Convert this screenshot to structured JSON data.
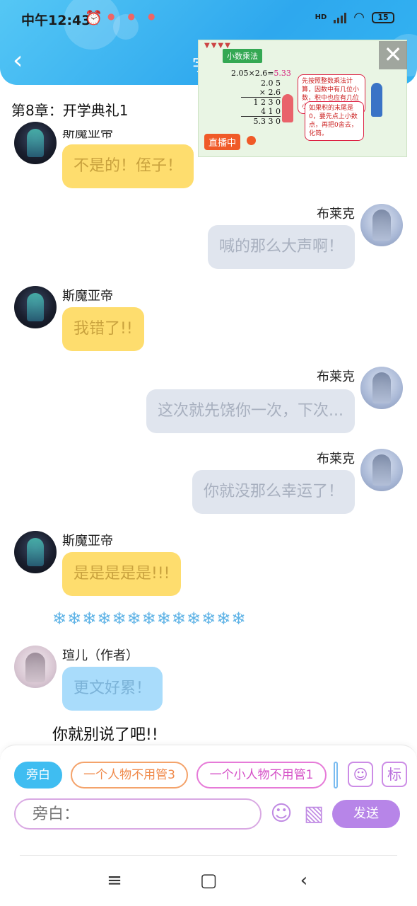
{
  "status_bar": {
    "time": "中午12:43",
    "battery": "15",
    "signal_label": "HD"
  },
  "header": {
    "back_icon": "chevron-left-icon",
    "title_fragment": "宇"
  },
  "chapter_title": "第8章：开学典礼1",
  "video": {
    "topic": "小数乘法",
    "equation": "2.05×2.6=",
    "answer": "5.33",
    "calc_lines": [
      "2.0 5",
      "× 2.6",
      "1 2 3 0",
      "4 1 0",
      "5.3 3 0"
    ],
    "speech_1": "先按照整数乘法计算，因数中有几位小数，积中也应有几位小数。",
    "speech_2": "如果积的末尾是0，要先点上小数点，再把0舍去，化简。",
    "live_label": "直播中",
    "close_icon": "close-icon"
  },
  "messages": [
    {
      "speaker": "斯魔亚帝",
      "side": "left",
      "text": "不是的！侄子！",
      "style": "yellow"
    },
    {
      "speaker": "布莱克",
      "side": "right",
      "text": "喊的那么大声啊！",
      "style": "gray"
    },
    {
      "speaker": "斯魔亚帝",
      "side": "left",
      "text": "我错了!!",
      "style": "yellow"
    },
    {
      "speaker": "布莱克",
      "side": "right",
      "text": "这次就先饶你一次，下次...",
      "style": "gray"
    },
    {
      "speaker": "布莱克",
      "side": "right",
      "text": "你就没那么幸运了！",
      "style": "gray"
    },
    {
      "speaker": "斯魔亚帝",
      "side": "left",
      "text": "是是是是是!!!",
      "style": "yellow"
    },
    {
      "speaker": "瑄儿（作者）",
      "side": "left",
      "text": "更文好累！",
      "style": "blue"
    }
  ],
  "separator": "❄❄❄❄❄❄❄❄❄❄❄❄❄",
  "narration_text": "你就别说了吧!!",
  "composer": {
    "chips": [
      "旁白",
      "一个人物不用管3",
      "一个小人物不用管1"
    ],
    "role_icon": "character-icon",
    "mark_label": "标",
    "input_placeholder": "旁白：",
    "emoji_icon": "emoji-icon",
    "image_icon": "image-icon",
    "send_label": "发送"
  },
  "nav": {
    "menu_icon": "menu-icon",
    "home_icon": "home-icon",
    "back_icon": "back-icon"
  },
  "colors": {
    "header": "#2ea8ee",
    "left_bubble": "#fedd6e",
    "right_bubble": "#e0e5ee",
    "author_bubble": "#a9dcfb",
    "send": "#b785e8"
  }
}
